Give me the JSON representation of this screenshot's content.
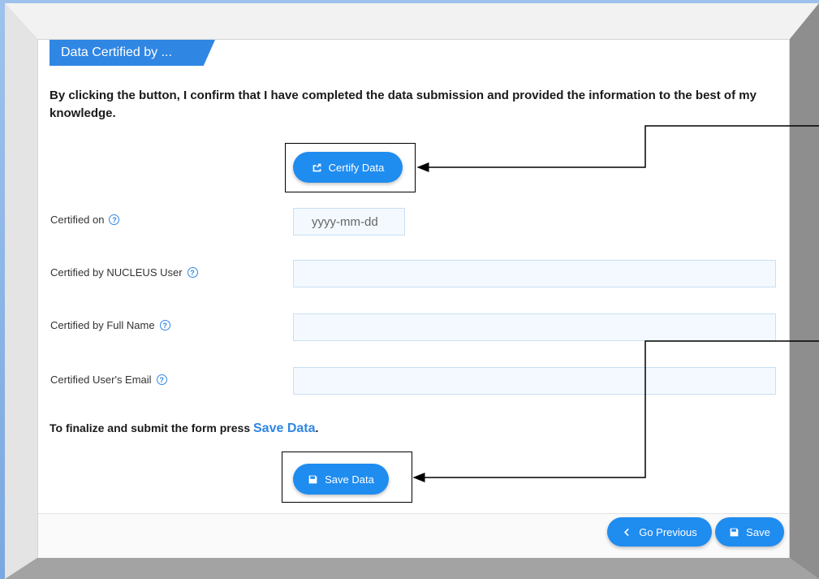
{
  "section": {
    "title": "Data Certified by ..."
  },
  "intro_text": "By clicking the button, I confirm that I have completed the data submission and provided the information to the best of my knowledge.",
  "certify_button": {
    "label": "Certify Data"
  },
  "fields": {
    "certified_on": {
      "label": "Certified on",
      "placeholder": "yyyy-mm-dd"
    },
    "nucleus_user": {
      "label": "Certified by NUCLEUS User",
      "value": ""
    },
    "full_name": {
      "label": "Certified by Full Name",
      "value": ""
    },
    "email": {
      "label": "Certified User's Email",
      "value": ""
    }
  },
  "help_glyph": "?",
  "finalize": {
    "text": "To finalize and submit the form press ",
    "link": "Save Data",
    "suffix": "."
  },
  "save_data_button": {
    "label": "Save Data"
  },
  "footer": {
    "go_previous": "Go Previous",
    "save": "Save"
  },
  "colors": {
    "accent": "#1f8cf0",
    "tab": "#2f86e3"
  },
  "icons": {
    "certify": "share-square-icon",
    "save": "floppy-disk-icon",
    "previous": "chevron-left-icon",
    "help": "question-circle-icon"
  }
}
